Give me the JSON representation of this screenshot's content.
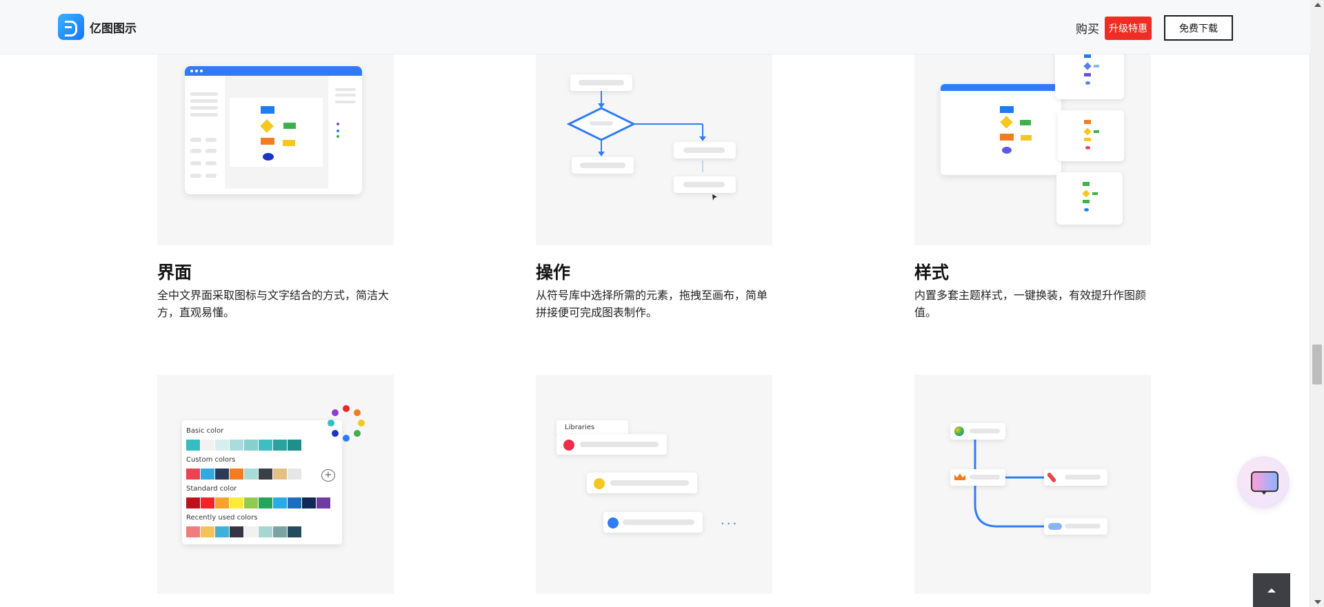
{
  "header": {
    "logo_text": "亿图图示",
    "buy": "购买",
    "badge": "升级特惠",
    "download": "免费下载"
  },
  "features": [
    {
      "title": "界面",
      "desc": "全中文界面采取图标与文字结合的方式，简洁大方，直观易懂。"
    },
    {
      "title": "操作",
      "desc": "从符号库中选择所需的元素，拖拽至画布，简单拼接便可完成图表制作。"
    },
    {
      "title": "样式",
      "desc": "内置多套主题样式，一键换装，有效提升作图颜值。"
    }
  ],
  "color_panel": {
    "basic": "Basic color",
    "custom": "Custom colors",
    "standard": "Standard color",
    "recent": "Recently used colors",
    "basic_colors": [
      "#36bdbf",
      "#f2f2f2",
      "#d8eeee",
      "#a9dcdc",
      "#88cfcf",
      "#3dbfbf",
      "#2aa39f",
      "#1f8f8a"
    ],
    "custom_colors": [
      "#e84552",
      "#36a7df",
      "#2b3a57",
      "#f47c20",
      "#a8dcd6",
      "#3b3f46",
      "#e5c083",
      "#e6e6e6"
    ],
    "standard_colors": [
      "#c0101c",
      "#f2232b",
      "#f7a22b",
      "#ffe93b",
      "#92c950",
      "#25a55a",
      "#2aace3",
      "#1d6fbb",
      "#0f2a59",
      "#6f3ca4"
    ],
    "recent_colors": [
      "#f27b7b",
      "#f4c25a",
      "#40b0d6",
      "#363445",
      "#f1f1f1",
      "#a8d5d2",
      "#7aa3a4",
      "#264a5e"
    ]
  },
  "libraries_label": "Libraries"
}
